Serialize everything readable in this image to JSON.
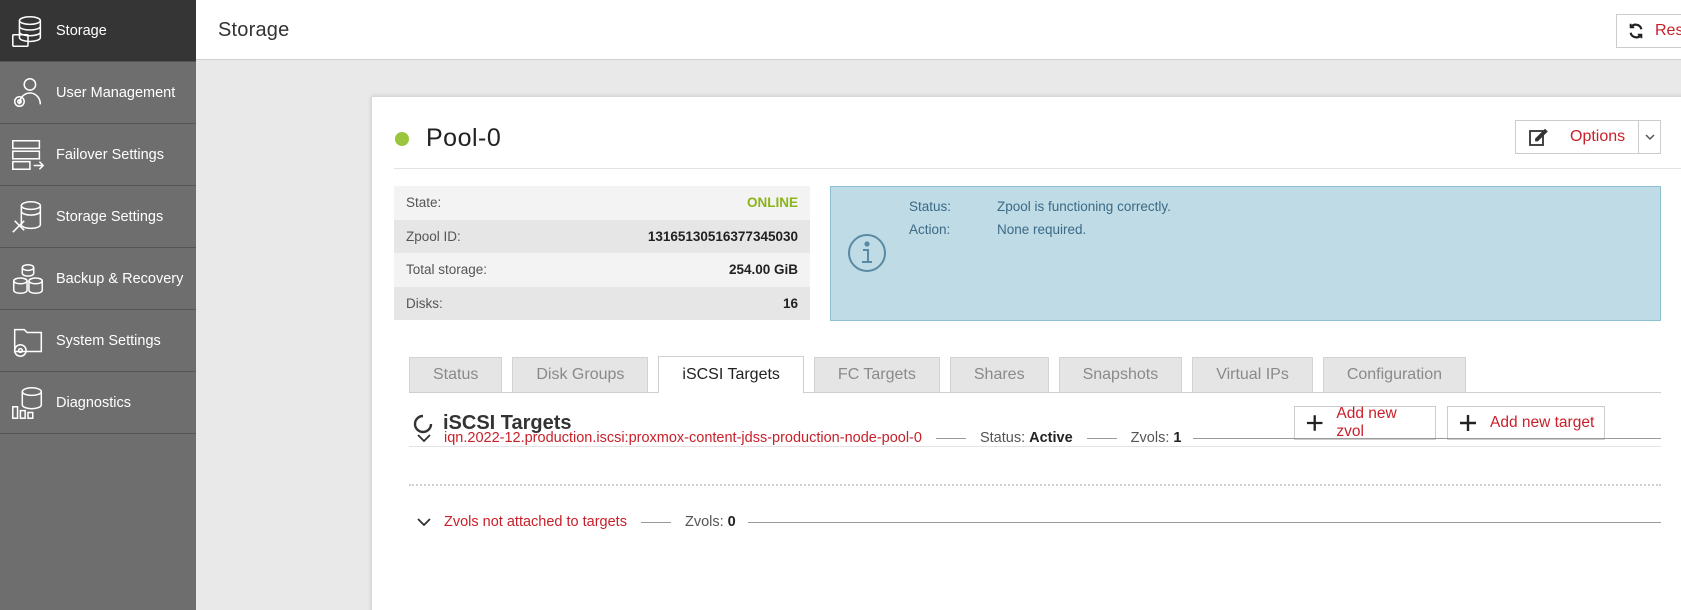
{
  "sidebar": {
    "items": [
      {
        "label": "Storage",
        "icon": "storage-icon",
        "active": true
      },
      {
        "label": "User Management",
        "icon": "user-management-icon"
      },
      {
        "label": "Failover Settings",
        "icon": "failover-icon"
      },
      {
        "label": "Storage Settings",
        "icon": "storage-settings-icon"
      },
      {
        "label": "Backup & Recovery",
        "icon": "backup-icon"
      },
      {
        "label": "System Settings",
        "icon": "system-settings-icon"
      },
      {
        "label": "Diagnostics",
        "icon": "diagnostics-icon"
      }
    ]
  },
  "header": {
    "title": "Storage",
    "rescan_label": "Res"
  },
  "pool": {
    "name": "Pool-0",
    "options_label": "Options",
    "info": [
      {
        "label": "State:",
        "value": "ONLINE"
      },
      {
        "label": "Zpool ID:",
        "value": "13165130516377345030"
      },
      {
        "label": "Total storage:",
        "value": "254.00 GiB"
      },
      {
        "label": "Disks:",
        "value": "16"
      }
    ],
    "status_box": {
      "status_label": "Status:",
      "status_value": "Zpool is functioning correctly.",
      "action_label": "Action:",
      "action_value": "None required."
    }
  },
  "tabs": [
    {
      "label": "Status"
    },
    {
      "label": "Disk Groups"
    },
    {
      "label": "iSCSI Targets",
      "active": true
    },
    {
      "label": "FC Targets"
    },
    {
      "label": "Shares"
    },
    {
      "label": "Snapshots"
    },
    {
      "label": "Virtual IPs"
    },
    {
      "label": "Configuration"
    }
  ],
  "section": {
    "title": "iSCSI Targets",
    "add_zvol_label": "Add new zvol",
    "add_target_label": "Add new target"
  },
  "targets": [
    {
      "name": "iqn.2022-12.production.iscsi:proxmox-content-jdss-production-node-pool-0",
      "status_label": "Status:",
      "status_value": "Active",
      "zvols_label": "Zvols:",
      "zvols_value": "1"
    }
  ],
  "unattached": {
    "name": "Zvols not attached to targets",
    "zvols_label": "Zvols:",
    "zvols_value": "0"
  },
  "colors": {
    "accent": "#c8202a",
    "online": "#8ab41b",
    "status_dot": "#9bc53d",
    "info_box_bg": "#bfdbe5",
    "sidebar_bg": "#6e6e6e",
    "sidebar_active": "#353535"
  }
}
